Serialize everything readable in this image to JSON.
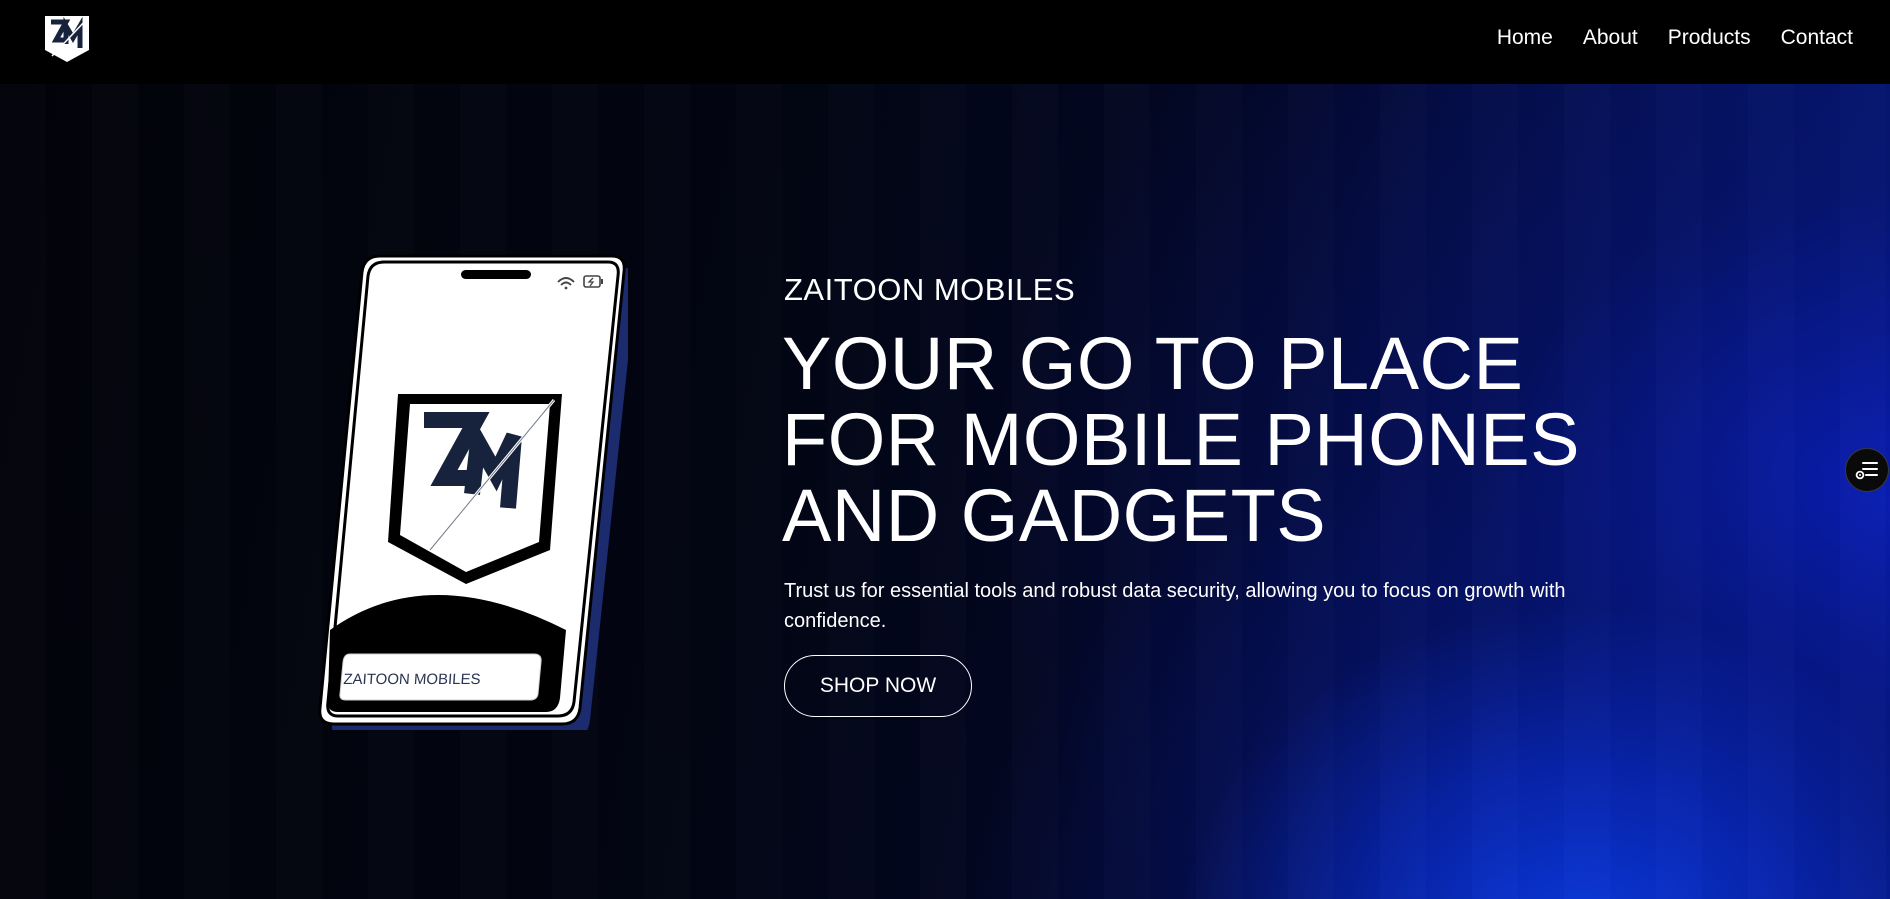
{
  "nav": {
    "logo_icon": "zm-shield-logo",
    "links": [
      "Home",
      "About",
      "Products",
      "Contact"
    ]
  },
  "hero": {
    "kicker": "ZAITOON MOBILES",
    "headline": "YOUR GO TO PLACE FOR MOBILE PHONES AND GADGETS",
    "subtext": "Trust us for essential tools and robust data security, allowing you to focus on growth with confidence.",
    "cta_label": "SHOP NOW",
    "phone_screen_label": "ZAITOON MOBILES"
  },
  "floating": {
    "icon": "settings-list-icon"
  },
  "colors": {
    "background": "#000000",
    "accent_blue": "#0a3ce6",
    "text": "#ffffff",
    "phone_shadow": "#1c2a6e"
  }
}
